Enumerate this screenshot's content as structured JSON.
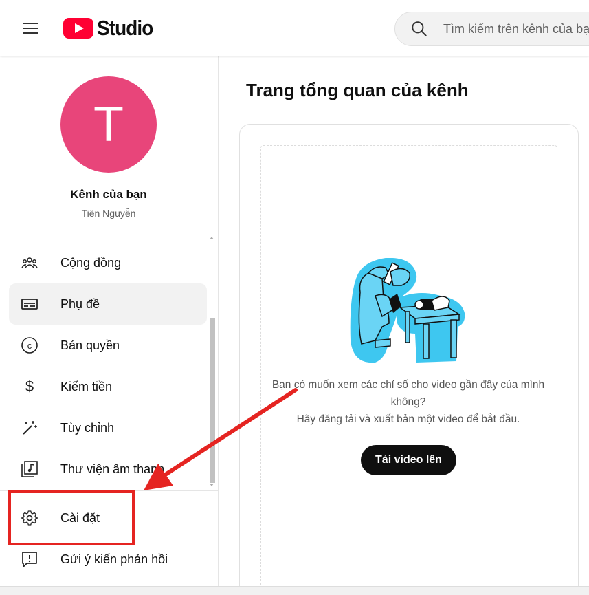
{
  "header": {
    "logo_text": "Studio",
    "search": {
      "placeholder": "Tìm kiếm trên kênh của bạn"
    }
  },
  "sidebar": {
    "avatar_letter": "T",
    "avatar_color": "#e8457a",
    "channel_name": "Kênh của bạn",
    "channel_user": "Tiên Nguyễn",
    "items": [
      {
        "label": "Cộng đồng",
        "icon": "people-icon"
      },
      {
        "label": "Phụ đề",
        "icon": "subtitles-icon",
        "active": true
      },
      {
        "label": "Bản quyền",
        "icon": "copyright-icon"
      },
      {
        "label": "Kiếm tiền",
        "icon": "dollar-icon"
      },
      {
        "label": "Tùy chỉnh",
        "icon": "magic-wand-icon"
      },
      {
        "label": "Thư viện âm thanh",
        "icon": "audio-library-icon"
      },
      {
        "label": "Cài đặt",
        "icon": "gear-icon"
      },
      {
        "label": "Gửi ý kiến phản hồi",
        "icon": "feedback-icon"
      }
    ]
  },
  "main": {
    "title": "Trang tổng quan của kênh",
    "empty_line1": "Bạn có muốn xem các chỉ số cho video gần đây của mình không?",
    "empty_line2": "Hãy đăng tải và xuất bản một video để bắt đầu.",
    "upload_label": "Tải video lên"
  },
  "colors": {
    "brand_red": "#ff0033",
    "annotation_red": "#e52421",
    "illustration_cyan": "#3ec7f0"
  }
}
